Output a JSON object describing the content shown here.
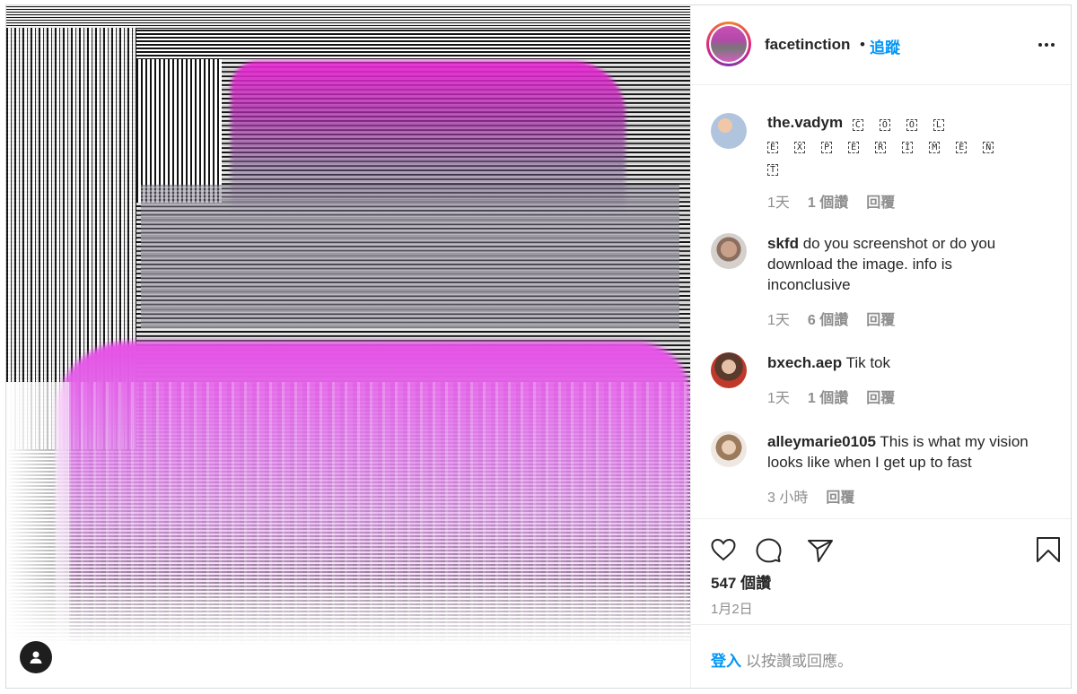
{
  "post": {
    "username": "facetinction",
    "separator": "•",
    "follow_label": "追蹤",
    "more_icon": "more-horizontal-icon"
  },
  "comments": [
    {
      "username": "the.vadym",
      "text": "",
      "glyphs_line1": [
        "C",
        "O",
        "O",
        "L"
      ],
      "glyphs_line2": [
        "E",
        "X",
        "P",
        "E",
        "R",
        "I",
        "M",
        "E",
        "N"
      ],
      "glyphs_line3": [
        "T"
      ],
      "time": "1天",
      "likes": "1 個讚",
      "reply": "回覆"
    },
    {
      "username": "skfd",
      "text": "do you screenshot or do you download the image. info is inconclusive",
      "time": "1天",
      "likes": "6 個讚",
      "reply": "回覆"
    },
    {
      "username": "bxech.aep",
      "text": "Tik tok",
      "time": "1天",
      "likes": "1 個讚",
      "reply": "回覆"
    },
    {
      "username": "alleymarie0105",
      "text": "This is what my vision looks like when I get up to fast",
      "time": "3 小時",
      "reply": "回覆"
    }
  ],
  "actions": {
    "like_icon": "heart-icon",
    "comment_icon": "comment-icon",
    "share_icon": "share-icon",
    "save_icon": "bookmark-icon",
    "likes_count": "547 個讚",
    "date": "1月2日"
  },
  "footer": {
    "login_label": "登入",
    "login_rest": "以按讚或回應。"
  },
  "media": {
    "user_tag_icon": "user-tag-icon"
  }
}
